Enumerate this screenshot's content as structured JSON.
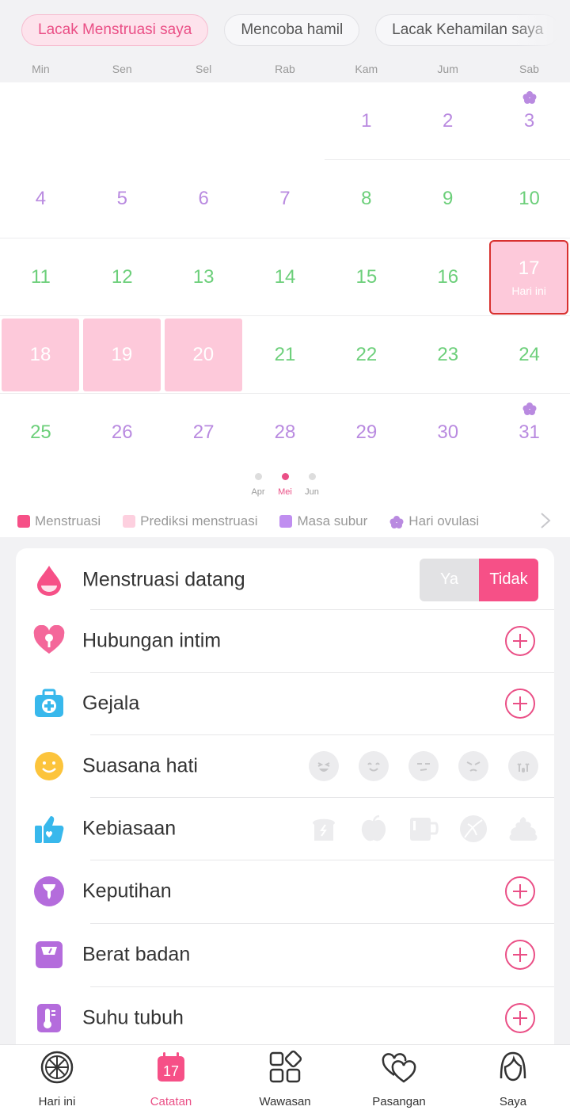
{
  "mode_tabs": [
    {
      "label": "Lacak Menstruasi saya",
      "active": true
    },
    {
      "label": "Mencoba hamil",
      "active": false
    },
    {
      "label": "Lacak Kehamilan saya",
      "active": false
    }
  ],
  "weekdays": [
    "Min",
    "Sen",
    "Sel",
    "Rab",
    "Kam",
    "Jum",
    "Sab"
  ],
  "calendar": {
    "today_label": "Hari ini",
    "ovulation_days": [
      3,
      31
    ],
    "rows": [
      [
        null,
        null,
        null,
        null,
        {
          "d": "1",
          "c": "purple"
        },
        {
          "d": "2",
          "c": "purple"
        },
        {
          "d": "3",
          "c": "purple"
        }
      ],
      [
        {
          "d": "4",
          "c": "purple"
        },
        {
          "d": "5",
          "c": "purple"
        },
        {
          "d": "6",
          "c": "purple"
        },
        {
          "d": "7",
          "c": "purple"
        },
        {
          "d": "8",
          "c": "green"
        },
        {
          "d": "9",
          "c": "green"
        },
        {
          "d": "10",
          "c": "green"
        }
      ],
      [
        {
          "d": "11",
          "c": "green"
        },
        {
          "d": "12",
          "c": "green"
        },
        {
          "d": "13",
          "c": "green"
        },
        {
          "d": "14",
          "c": "green"
        },
        {
          "d": "15",
          "c": "green"
        },
        {
          "d": "16",
          "c": "green"
        },
        {
          "d": "17",
          "c": "today"
        }
      ],
      [
        {
          "d": "18",
          "c": "period"
        },
        {
          "d": "19",
          "c": "period"
        },
        {
          "d": "20",
          "c": "period"
        },
        {
          "d": "21",
          "c": "green"
        },
        {
          "d": "22",
          "c": "green"
        },
        {
          "d": "23",
          "c": "green"
        },
        {
          "d": "24",
          "c": "green"
        }
      ],
      [
        {
          "d": "25",
          "c": "green"
        },
        {
          "d": "26",
          "c": "purple"
        },
        {
          "d": "27",
          "c": "purple"
        },
        {
          "d": "28",
          "c": "purple"
        },
        {
          "d": "29",
          "c": "purple"
        },
        {
          "d": "30",
          "c": "purple"
        },
        {
          "d": "31",
          "c": "purple"
        }
      ]
    ]
  },
  "months": [
    {
      "label": "Apr",
      "active": false
    },
    {
      "label": "Mei",
      "active": true
    },
    {
      "label": "Jun",
      "active": false
    }
  ],
  "legend": [
    {
      "label": "Menstruasi",
      "color": "#f65087",
      "shape": "square"
    },
    {
      "label": "Prediksi menstruasi",
      "color": "#fdd0df",
      "shape": "square"
    },
    {
      "label": "Masa subur",
      "color": "#c08ef0",
      "shape": "square"
    },
    {
      "label": "Hari ovulasi",
      "color": "#b98ae0",
      "shape": "flower"
    }
  ],
  "records": [
    {
      "name": "menstruasi-datang",
      "label": "Menstruasi datang",
      "icon": "drop-icon",
      "control": "toggle",
      "toggle": {
        "yes": "Ya",
        "no": "Tidak",
        "selected": "Tidak"
      }
    },
    {
      "name": "hubungan-intim",
      "label": "Hubungan intim",
      "icon": "heart-icon",
      "control": "plus"
    },
    {
      "name": "gejala",
      "label": "Gejala",
      "icon": "medical-kit-icon",
      "control": "plus"
    },
    {
      "name": "suasana-hati",
      "label": "Suasana hati",
      "icon": "smiley-icon",
      "control": "moods",
      "items": [
        "laughing-face-icon",
        "smiling-face-icon",
        "annoyed-face-icon",
        "angry-face-icon",
        "crying-face-icon"
      ]
    },
    {
      "name": "kebiasaan",
      "label": "Kebiasaan",
      "icon": "thumbs-up-icon",
      "control": "habits",
      "items": [
        "bread-icon",
        "apple-icon",
        "cup-icon",
        "ball-icon",
        "poop-icon"
      ]
    },
    {
      "name": "keputihan",
      "label": "Keputihan",
      "icon": "discharge-icon",
      "control": "plus"
    },
    {
      "name": "berat-badan",
      "label": "Berat badan",
      "icon": "scale-icon",
      "control": "plus"
    },
    {
      "name": "suhu-tubuh",
      "label": "Suhu tubuh",
      "icon": "thermometer-icon",
      "control": "plus"
    }
  ],
  "bottom_nav": [
    {
      "name": "hari-ini",
      "label": "Hari ini",
      "icon": "orange-slice-icon",
      "active": false
    },
    {
      "name": "catatan",
      "label": "Catatan",
      "icon": "calendar-17-icon",
      "active": true,
      "calendar_day": "17"
    },
    {
      "name": "wawasan",
      "label": "Wawasan",
      "icon": "grid-icon",
      "active": false
    },
    {
      "name": "pasangan",
      "label": "Pasangan",
      "icon": "two-hearts-icon",
      "active": false
    },
    {
      "name": "saya",
      "label": "Saya",
      "icon": "person-icon",
      "active": false
    }
  ],
  "colors": {
    "accent": "#ea4f86",
    "period": "#fdc9da",
    "fertile_text": "#b98ae0",
    "safe_text": "#6ccf7a",
    "today_border": "#d8312f"
  }
}
